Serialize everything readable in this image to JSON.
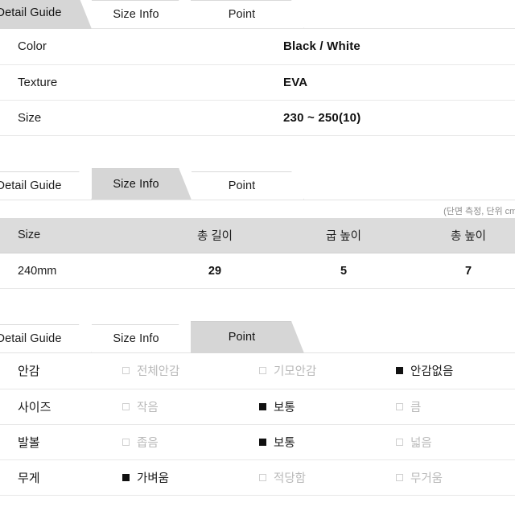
{
  "tabs": [
    "Detail Guide",
    "Size Info",
    "Point"
  ],
  "sections": [
    {
      "id": "detail-guide",
      "active_tab": 0,
      "rows": [
        {
          "key": "Color",
          "value": "Black / White"
        },
        {
          "key": "Texture",
          "value": "EVA"
        },
        {
          "key": "Size",
          "value": "230 ~ 250(10)"
        }
      ]
    },
    {
      "id": "size-info",
      "active_tab": 1,
      "note": "(단면 측정, 단위 cm)",
      "headers": [
        "Size",
        "총 길이",
        "굽 높이",
        "총 높이"
      ],
      "rows": [
        [
          "240mm",
          "29",
          "5",
          "7"
        ]
      ]
    },
    {
      "id": "point",
      "active_tab": 2,
      "rows": [
        {
          "label": "안감",
          "options": [
            {
              "text": "전체안감",
              "checked": false
            },
            {
              "text": "기모안감",
              "checked": false
            },
            {
              "text": "안감없음",
              "checked": true
            }
          ]
        },
        {
          "label": "사이즈",
          "options": [
            {
              "text": "작음",
              "checked": false
            },
            {
              "text": "보통",
              "checked": true
            },
            {
              "text": "큼",
              "checked": false
            }
          ]
        },
        {
          "label": "발볼",
          "options": [
            {
              "text": "좁음",
              "checked": false
            },
            {
              "text": "보통",
              "checked": true
            },
            {
              "text": "넓음",
              "checked": false
            }
          ]
        },
        {
          "label": "무게",
          "options": [
            {
              "text": "가벼움",
              "checked": true
            },
            {
              "text": "적당함",
              "checked": false
            },
            {
              "text": "무거움",
              "checked": false
            }
          ]
        }
      ]
    }
  ],
  "colors": {
    "active_tab_bg": "#d6d6d6",
    "header_bg": "#dcdcdc",
    "row_border": "#e8e8e8",
    "checked_box": "#111111",
    "unchecked_text": "#b9b9b9"
  }
}
